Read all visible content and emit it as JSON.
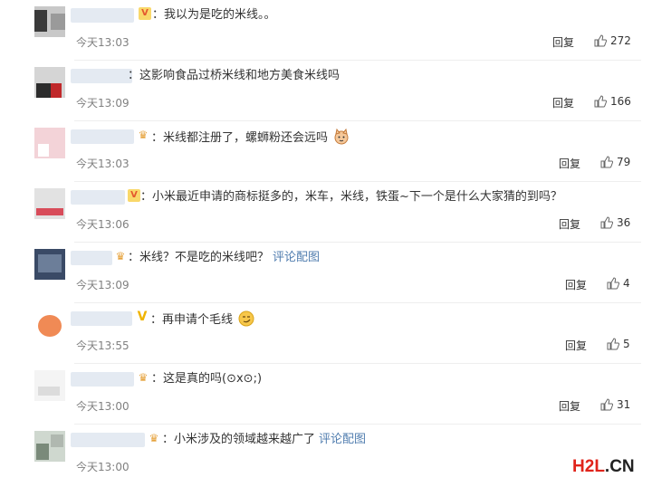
{
  "comments": [
    {
      "text": "我以为是吃的米线。。",
      "time": "今天13:03",
      "reply": "回复",
      "likes": "272",
      "link": ""
    },
    {
      "text": "这影响食品过桥米线和地方美食米线吗",
      "time": "今天13:09",
      "reply": "回复",
      "likes": "166",
      "link": ""
    },
    {
      "text": "米线都注册了，螺蛳粉还会远吗",
      "time": "今天13:03",
      "reply": "回复",
      "likes": "79",
      "link": ""
    },
    {
      "text": "小米最近申请的商标挺多的，米车，米线，铁蛋~下一个是什么大家猜的到吗？",
      "time": "今天13:06",
      "reply": "回复",
      "likes": "36",
      "link": ""
    },
    {
      "text": "米线？不是吃的米线吧？",
      "time": "今天13:09",
      "reply": "回复",
      "likes": "4",
      "link": "评论配图"
    },
    {
      "text": "再申请个毛线",
      "time": "今天13:55",
      "reply": "回复",
      "likes": "5",
      "link": ""
    },
    {
      "text": "这是真的吗(⊙x⊙;)",
      "time": "今天13:00",
      "reply": "回复",
      "likes": "31",
      "link": ""
    },
    {
      "text": "小米涉及的领域越来越广了",
      "time": "今天13:00",
      "reply": "回复",
      "likes": "",
      "link": "评论配图"
    }
  ],
  "watermark": {
    "h": "H",
    "two": "2",
    "l": "L",
    "dot": ".",
    "cn": "CN"
  },
  "icons": {
    "badge_v": "vip-v-badge-icon",
    "badge_crown": "crown-badge-icon",
    "like": "thumbs-up-icon",
    "emoji_cat": "cat-emoji-icon",
    "emoji_smile": "smirk-emoji-icon"
  },
  "colors": {
    "link": "#507daf",
    "time": "#808080",
    "watermark_red": "#e0241b"
  }
}
